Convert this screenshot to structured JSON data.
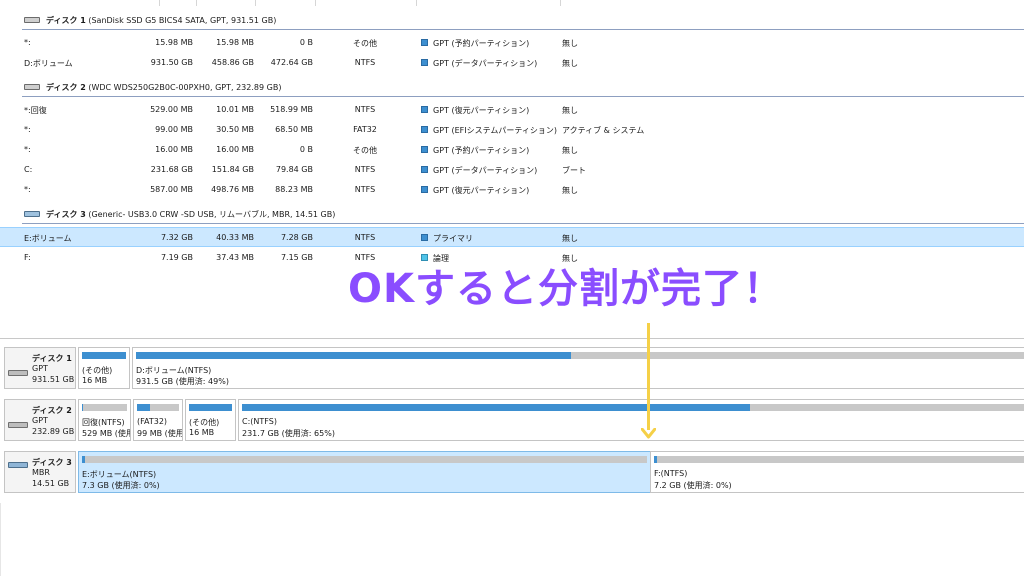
{
  "partition_list": {
    "disks": [
      {
        "title_bold": "ディスク 1",
        "title_rest": " (SanDisk SSD G5 BICS4 SATA, GPT, 931.51 GB)",
        "icon": "hdd-icon",
        "rows": [
          {
            "name": "*:",
            "capacity": "15.98 MB",
            "used": "15.98 MB",
            "free": "0 B",
            "fs": "その他",
            "type": "GPT (予約パーティション)",
            "status": "無し",
            "type_color": "#3d8fd0"
          },
          {
            "name": "D:ボリューム",
            "capacity": "931.50 GB",
            "used": "458.86 GB",
            "free": "472.64 GB",
            "fs": "NTFS",
            "type": "GPT (データパーティション)",
            "status": "無し",
            "type_color": "#3d8fd0"
          }
        ]
      },
      {
        "title_bold": "ディスク 2",
        "title_rest": " (WDC WDS250G2B0C-00PXH0, GPT, 232.89 GB)",
        "icon": "hdd-icon",
        "rows": [
          {
            "name": "*:回復",
            "capacity": "529.00 MB",
            "used": "10.01 MB",
            "free": "518.99 MB",
            "fs": "NTFS",
            "type": "GPT (復元パーティション)",
            "status": "無し",
            "type_color": "#3d8fd0"
          },
          {
            "name": "*:",
            "capacity": "99.00 MB",
            "used": "30.50 MB",
            "free": "68.50 MB",
            "fs": "FAT32",
            "type": "GPT (EFIシステムパーティション)",
            "status": "アクティブ & システム",
            "type_color": "#3d8fd0"
          },
          {
            "name": "*:",
            "capacity": "16.00 MB",
            "used": "16.00 MB",
            "free": "0 B",
            "fs": "その他",
            "type": "GPT (予約パーティション)",
            "status": "無し",
            "type_color": "#3d8fd0"
          },
          {
            "name": "C:",
            "capacity": "231.68 GB",
            "used": "151.84 GB",
            "free": "79.84 GB",
            "fs": "NTFS",
            "type": "GPT (データパーティション)",
            "status": "ブート",
            "type_color": "#3d8fd0"
          },
          {
            "name": "*:",
            "capacity": "587.00 MB",
            "used": "498.76 MB",
            "free": "88.23 MB",
            "fs": "NTFS",
            "type": "GPT (復元パーティション)",
            "status": "無し",
            "type_color": "#3d8fd0"
          }
        ]
      },
      {
        "title_bold": "ディスク 3",
        "title_rest": " (Generic- USB3.0 CRW -SD USB, リムーバブル, MBR, 14.51 GB)",
        "icon": "usb-drive-icon",
        "rows": [
          {
            "name": "E:ボリューム",
            "capacity": "7.32 GB",
            "used": "40.33 MB",
            "free": "7.28 GB",
            "fs": "NTFS",
            "type": "プライマリ",
            "status": "無し",
            "type_color": "#3d8fd0",
            "selected": true
          },
          {
            "name": "F:",
            "capacity": "7.19 GB",
            "used": "37.43 MB",
            "free": "7.15 GB",
            "fs": "NTFS",
            "type": "論理",
            "status": "無し",
            "type_color": "#4fc3e8"
          }
        ]
      }
    ]
  },
  "disk_map": [
    {
      "name": "ディスク 1",
      "kind": "GPT",
      "size": "931.51 GB",
      "icon": "hdd-icon",
      "partitions": [
        {
          "title": "(その他)",
          "sub": "16 MB",
          "used_fraction": 1.0
        },
        {
          "title": "D:ボリューム(NTFS)",
          "sub": "931.5 GB (使用済: 49%)",
          "used_fraction": 0.49
        }
      ]
    },
    {
      "name": "ディスク 2",
      "kind": "GPT",
      "size": "232.89 GB",
      "icon": "hdd-icon",
      "partitions": [
        {
          "title": "回復(NTFS)",
          "sub": "529 MB (使用",
          "used_fraction": 0.02
        },
        {
          "title": "(FAT32)",
          "sub": "99 MB (使用済",
          "used_fraction": 0.31
        },
        {
          "title": "(その他)",
          "sub": "16 MB",
          "used_fraction": 1.0
        },
        {
          "title": "C:(NTFS)",
          "sub": "231.7 GB (使用済: 65%)",
          "used_fraction": 0.65
        }
      ]
    },
    {
      "name": "ディスク 3",
      "kind": "MBR",
      "size": "14.51 GB",
      "icon": "usb-drive-icon",
      "partitions": [
        {
          "title": "E:ボリューム(NTFS)",
          "sub": "7.3 GB (使用済: 0%)",
          "used_fraction": 0.0,
          "selected": true
        },
        {
          "title": "F:(NTFS)",
          "sub": "7.2 GB (使用済: 0%)",
          "used_fraction": 0.0
        }
      ]
    }
  ],
  "annotation": {
    "text": "OKすると分割が完了！",
    "color": "#8a4dff",
    "arrow_color": "#f5d047"
  }
}
